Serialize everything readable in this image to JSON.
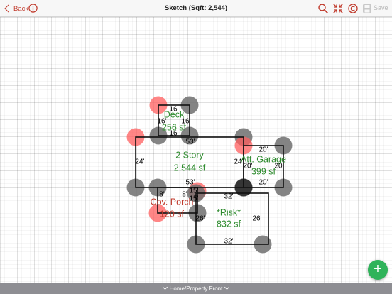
{
  "navbar": {
    "back_label": "Back",
    "title": "Sketch (Sqft: 2,544)",
    "save_label": "Save",
    "icons": [
      "info-icon",
      "search-icon",
      "collapse-icon",
      "copyright-icon",
      "save-disk-icon"
    ],
    "accent_color": "#c0392b"
  },
  "sketch": {
    "handle_colors": {
      "default": "#6e6e6e",
      "selected": "#ff5e5e",
      "active": "#303030"
    },
    "text_colors": {
      "area_label": "#2e8b2e",
      "selected_label": "#c0392b",
      "dimension": "#000000"
    },
    "areas": [
      {
        "id": "deck",
        "name": "Deck",
        "sqft": "256 sf",
        "dimensions": {
          "top": "16'",
          "bottom": "16'",
          "left": "16'",
          "right": "16'"
        }
      },
      {
        "id": "two-story",
        "name": "2 Story",
        "sqft": "2,544 sf",
        "dimensions": {
          "top": "53'",
          "bottom": "53'",
          "left": "24'",
          "right": "24'"
        }
      },
      {
        "id": "att-garage",
        "name": "Att. Garage",
        "sqft": "399 sf",
        "dimensions": {
          "top": "20'",
          "bottom": "20'",
          "left": "20'",
          "right": "20'"
        }
      },
      {
        "id": "cov-porch",
        "name": "Cov. Porch",
        "sqft": "120 sf",
        "dimensions": {
          "top": "15'",
          "bottom": "15'",
          "left": "8'",
          "right": "8'"
        }
      },
      {
        "id": "risk",
        "name": "*Risk*",
        "sqft": "832 sf",
        "dimensions": {
          "top": "32'",
          "bottom": "32'",
          "left": "26'",
          "right": "26'"
        }
      }
    ]
  },
  "bottom_bar": {
    "label": "Home/Property Front"
  },
  "fab": {
    "label": "+"
  }
}
